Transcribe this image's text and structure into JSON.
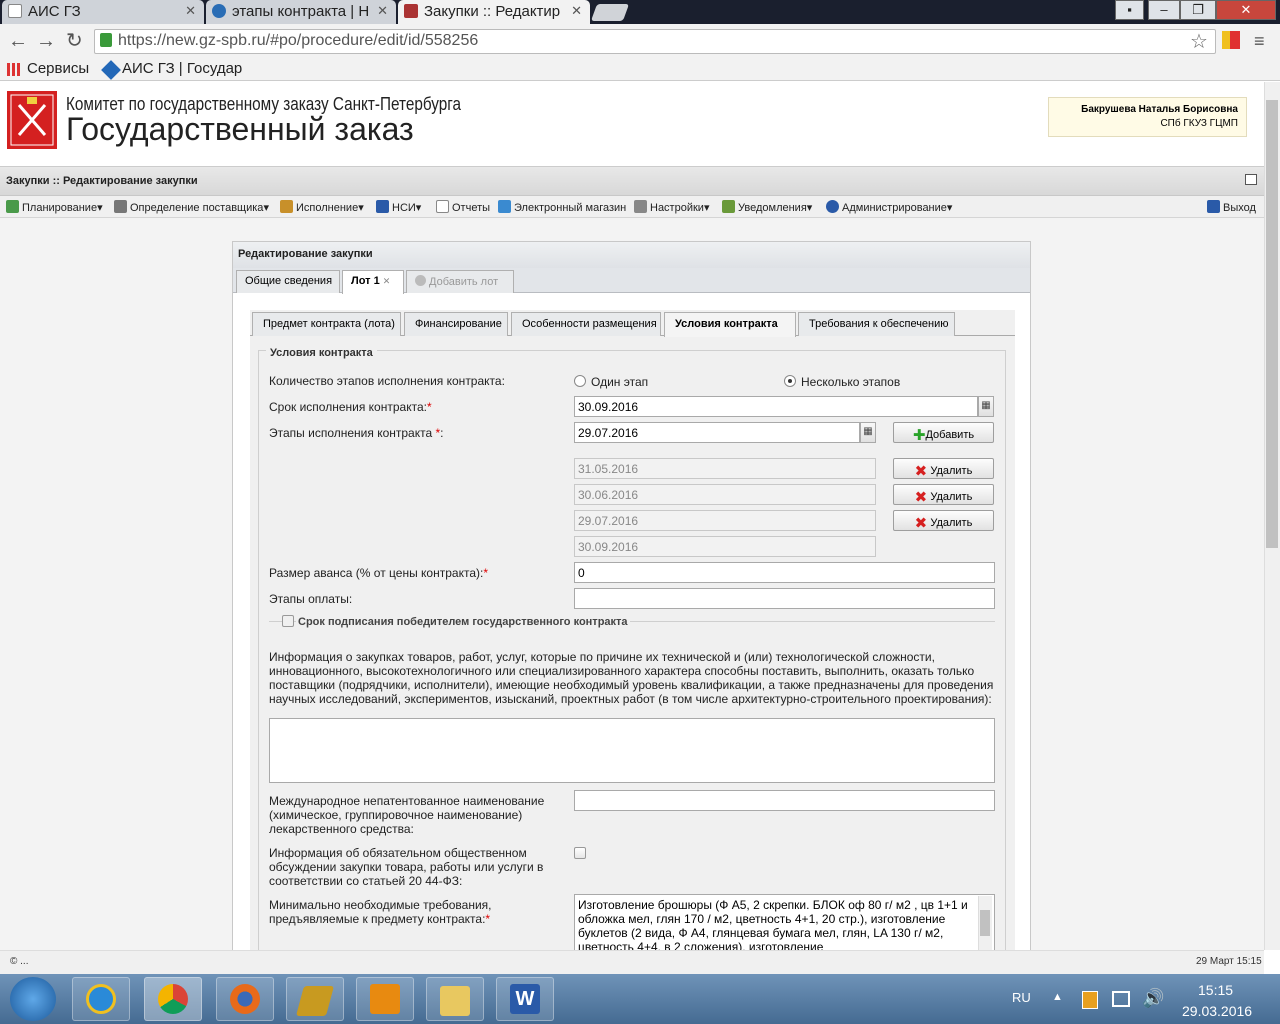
{
  "browser": {
    "tabs": [
      {
        "label": "АИС ГЗ"
      },
      {
        "label": "этапы контракта | Н"
      },
      {
        "label": "Закупки :: Редактир"
      }
    ],
    "url": "https://new.gz-spb.ru/#po/procedure/edit/id/558256",
    "bookmarks": [
      "Сервисы",
      "АИС ГЗ | Государ"
    ]
  },
  "header": {
    "org_line1": "Комитет по государственному заказу Санкт-Петербурга",
    "org_line2": "Государственный заказ",
    "user_name": "Бакрушева Наталья Борисовна",
    "user_org": "СПб ГКУЗ ГЦМП"
  },
  "section_title": "Закупки :: Редактирование закупки",
  "menu": {
    "items": [
      "Планирование",
      "Определение поставщика",
      "Исполнение",
      "НСИ",
      "Отчеты",
      "Электронный магазин",
      "Настройки",
      "Уведомления",
      "Администрирование"
    ],
    "logout": "Выход"
  },
  "panel": {
    "title": "Редактирование закупки",
    "tabs": [
      "Общие сведения",
      "Лот 1",
      "Добавить лот"
    ],
    "subtabs": [
      "Предмет контракта (лота)",
      "Финансирование",
      "Особенности размещения",
      "Условия контракта",
      "Требования к обеспечению"
    ]
  },
  "form": {
    "legend": "Условия контракта",
    "stages_count_label": "Количество этапов исполнения контракта:",
    "radio_one": "Один этап",
    "radio_many": "Несколько этапов",
    "term_label": "Срок исполнения контракта:",
    "term_value": "30.09.2016",
    "stages_label": "Этапы исполнения контракта ",
    "stage_input": "29.07.2016",
    "add_label": "Добавить",
    "stage_dates": [
      "31.05.2016",
      "30.06.2016",
      "29.07.2016",
      "30.09.2016"
    ],
    "delete_label": "Удалить",
    "advance_label": "Размер аванса (% от цены контракта):",
    "advance_value": "0",
    "payment_stages_label": "Этапы оплаты:",
    "signing_label": "Срок подписания победителем государственного контракта",
    "info_text": "Информация о закупках товаров, работ, услуг, которые по причине их технической и (или) технологической сложности, инновационного, высокотехнологичного или специализированного характера способны поставить, выполнить, оказать только поставщики (подрядчики, исполнители), имеющие необходимый уровень квалификации, а также предназначены для проведения научных исследований, экспериментов, изысканий, проектных работ (в том числе архитектурно-строительного проектирования):",
    "inn_label": "Международное непатентованное наименование (химическое, группировочное наименование) лекарственного средства:",
    "discussion_label": "Информация об обязательном общественном обсуждении закупки товара, работы или услуги в соответствии со статьей 20 44-ФЗ:",
    "requirements_label": "Минимально необходимые требования, предъявляемые к предмету контракта:",
    "requirements_text": "Изготовление брошюры (Ф А5, 2 скрепки. БЛОК оф 80 г/ м2 , цв 1+1 и обложка мел, глян 170 / м2, цветность   4+1,  20 стр.), изготовление буклетов (2 вида, Ф А4,   глянцевая бумага мел, глян, LA 130 г/ м2,  цветность 4+4, в 2 сложения), изготовление"
  },
  "status": {
    "left": "© ...",
    "right": "29 Март 15:15"
  },
  "taskbar": {
    "lang": "RU",
    "time": "15:15",
    "date": "29.03.2016"
  }
}
